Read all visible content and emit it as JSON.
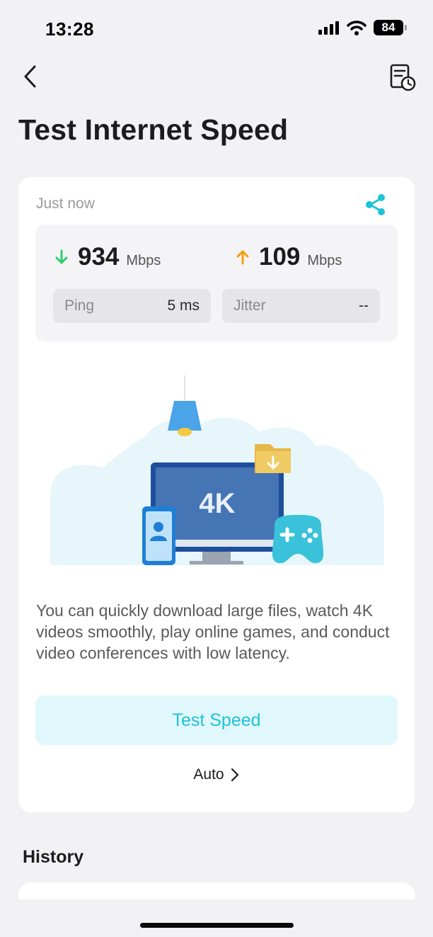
{
  "status_bar": {
    "time": "13:28",
    "battery": "84"
  },
  "header": {
    "title": "Test Internet Speed"
  },
  "result": {
    "time_label": "Just now",
    "download": {
      "value": "934",
      "unit": "Mbps"
    },
    "upload": {
      "value": "109",
      "unit": "Mbps"
    },
    "ping": {
      "label": "Ping",
      "value": "5 ms"
    },
    "jitter": {
      "label": "Jitter",
      "value": "--"
    }
  },
  "illustration": {
    "screen_text": "4K"
  },
  "description": "You can quickly download large files, watch 4K videos smoothly, play online games, and conduct video conferences with low latency.",
  "actions": {
    "test_speed_label": "Test Speed",
    "mode_label": "Auto"
  },
  "history": {
    "title": "History"
  },
  "colors": {
    "accent": "#1fc3d8",
    "download": "#2ecc71",
    "upload": "#f59e0b"
  }
}
